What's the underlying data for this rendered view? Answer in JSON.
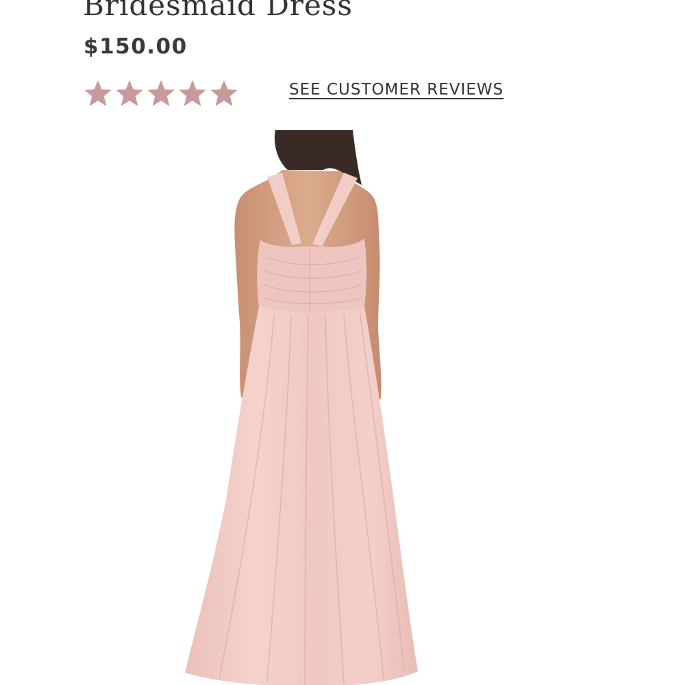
{
  "product": {
    "title": "Bridesmaid Dress",
    "price": "$150.00",
    "rating": {
      "value": 5,
      "max": 5,
      "star_color": "#c99a9c"
    },
    "reviews_link_label": "SEE CUSTOMER REVIEWS",
    "image": {
      "dress_color": "#f0c9c3",
      "skin_color": "#d9a88a",
      "hair_color": "#3a2a26"
    }
  }
}
